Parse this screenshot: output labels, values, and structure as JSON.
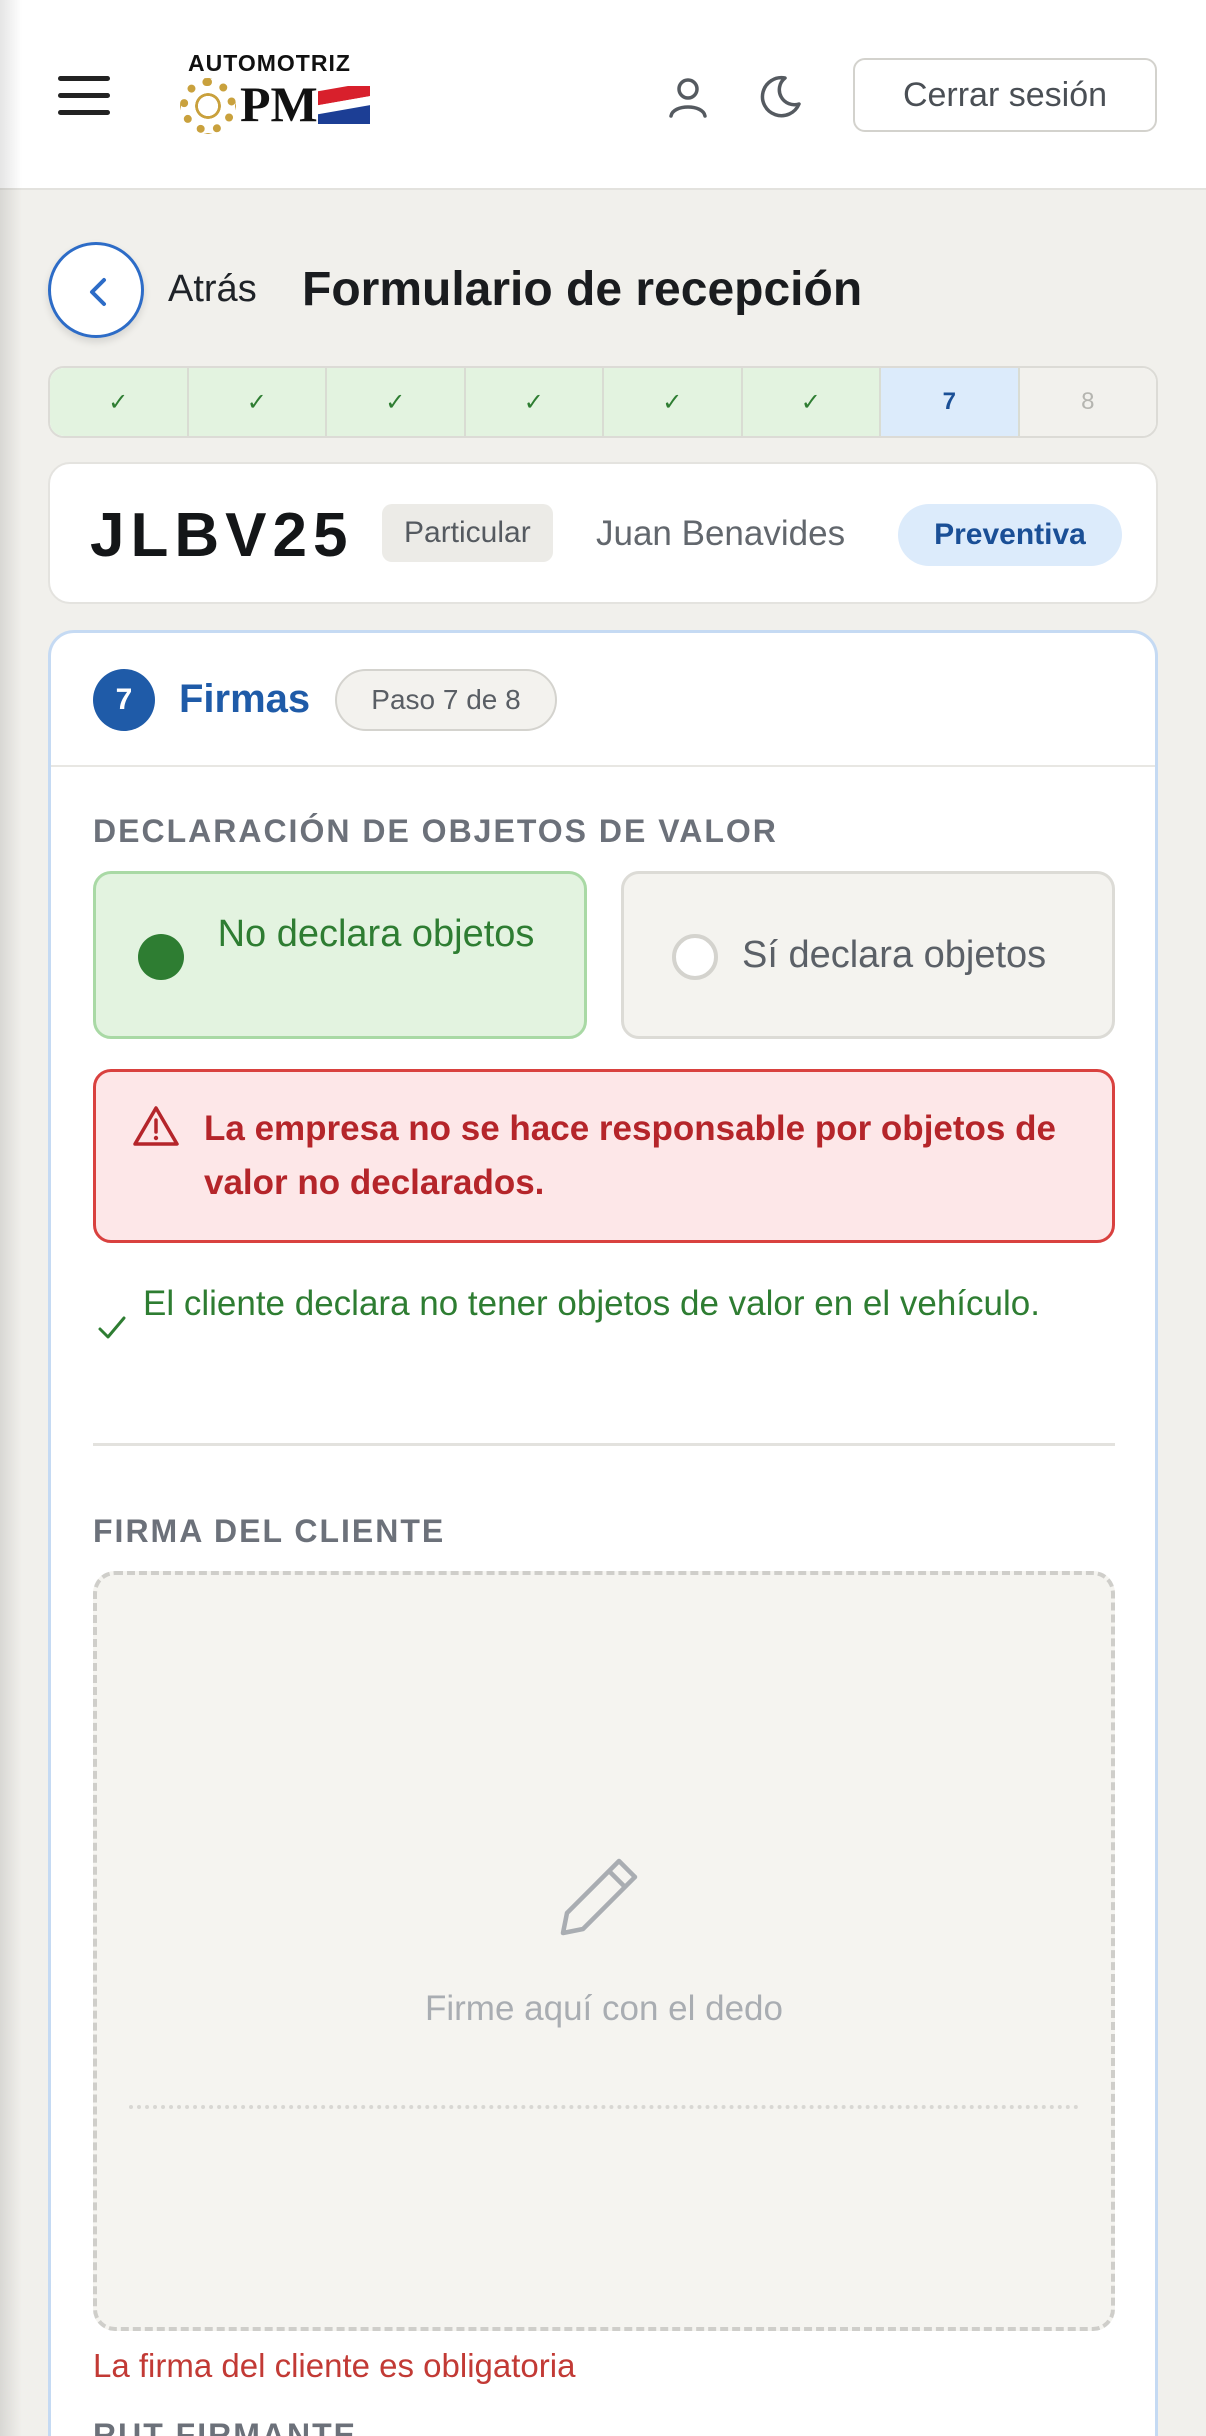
{
  "header": {
    "brand_top": "AUTOMOTRIZ",
    "brand_mark": "PM",
    "logout_label": "Cerrar sesión",
    "icons": [
      "menu-icon",
      "user-icon",
      "moon-icon"
    ]
  },
  "nav": {
    "back_label": "Atrás",
    "title": "Formulario de recepción"
  },
  "stepper": {
    "steps": [
      {
        "label": "✓",
        "state": "done"
      },
      {
        "label": "✓",
        "state": "done"
      },
      {
        "label": "✓",
        "state": "done"
      },
      {
        "label": "✓",
        "state": "done"
      },
      {
        "label": "✓",
        "state": "done"
      },
      {
        "label": "✓",
        "state": "done"
      },
      {
        "label": "7",
        "state": "current"
      },
      {
        "label": "8",
        "state": "pending"
      }
    ]
  },
  "vehicle": {
    "plate": "JLBV25",
    "type": "Particular",
    "owner": "Juan Benavides",
    "service": "Preventiva"
  },
  "section": {
    "number": "7",
    "title": "Firmas",
    "step_label": "Paso 7 de 8"
  },
  "valuables": {
    "label": "DECLARACIÓN DE OBJETOS DE VALOR",
    "option_no": "No declara objetos",
    "option_yes": "Sí declara objetos",
    "selected": "no",
    "warning": "La empresa no se hace responsable por objetos de valor no declarados.",
    "confirmation": "El cliente declara no tener objetos de valor en el vehículo."
  },
  "signature": {
    "label": "FIRMA DEL CLIENTE",
    "hint": "Firme aquí con el dedo",
    "error": "La firma del cliente es obligatoria"
  },
  "next_section": {
    "label": "RUT FIRMANTE"
  },
  "colors": {
    "primary": "#1f5ba8",
    "success": "#2e7d32",
    "danger": "#b5252a",
    "background": "#f1f0ec"
  }
}
